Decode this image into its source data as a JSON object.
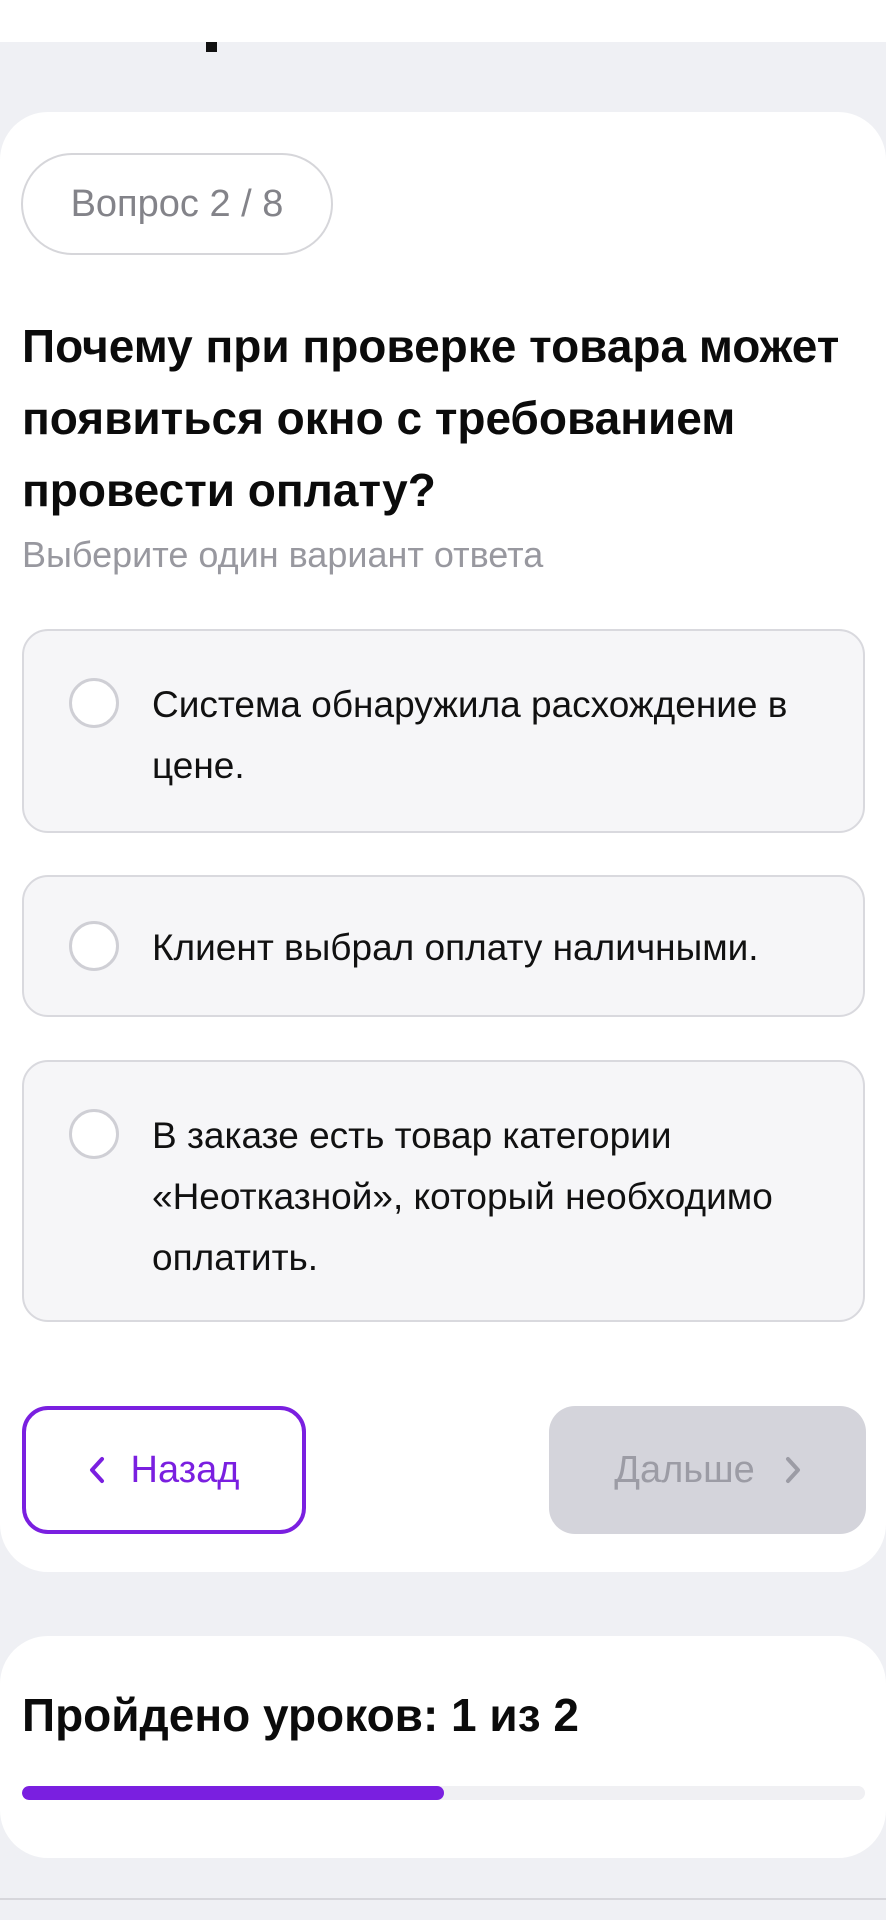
{
  "quiz": {
    "counter": "Вопрос 2 / 8",
    "question": "Почему при проверке товара может появиться окно с требованием провести оплату?",
    "hint": "Выберите один вариант ответа",
    "options": [
      {
        "text": "Система обнаружила расхождение в цене.",
        "selected": false
      },
      {
        "text": "Клиент выбрал оплату наличными.",
        "selected": false
      },
      {
        "text": "В заказе есть товар категории «Неотказной», который необходимо оплатить.",
        "selected": false
      }
    ]
  },
  "nav": {
    "back_label": "Назад",
    "next_label": "Дальше",
    "next_enabled": false
  },
  "progress": {
    "title": "Пройдено уроков: 1 из 2",
    "completed": 1,
    "total": 2
  },
  "colors": {
    "accent": "#7a1fe0",
    "disabled_bg": "#d4d4db",
    "disabled_text": "#9c9ca5"
  },
  "icons": {
    "back": "chevron-left-icon",
    "next": "chevron-right-icon",
    "radio": "radio-unchecked-icon"
  }
}
